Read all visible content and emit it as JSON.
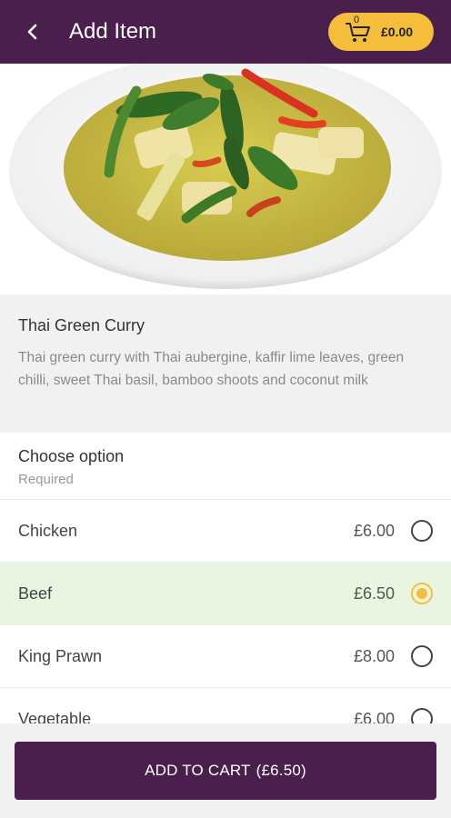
{
  "appbar": {
    "title": "Add Item",
    "back_icon": "arrow-left-icon"
  },
  "cart": {
    "count": "0",
    "total": "£0.00",
    "icon": "cart-icon",
    "color": "#f6bd3a"
  },
  "hero": {
    "alt": "Thai Green Curry dish",
    "expand_icon": "expand-icon"
  },
  "item": {
    "name": "Thai Green Curry",
    "description": "Thai green curry with Thai aubergine, kaffir lime leaves, green chilli, sweet Thai basil, bamboo shoots and coconut milk"
  },
  "options": {
    "title": "Choose option",
    "required": "Required",
    "items": [
      {
        "label": "Chicken",
        "price": "£6.00",
        "selected": false
      },
      {
        "label": "Beef",
        "price": "£6.50",
        "selected": true
      },
      {
        "label": "King Prawn",
        "price": "£8.00",
        "selected": false
      },
      {
        "label": "Vegetable",
        "price": "£6.00",
        "selected": false
      }
    ]
  },
  "footer": {
    "add_label": "ADD TO CART",
    "add_price": "(£6.50)"
  },
  "colors": {
    "brand": "#4a1f4e",
    "accent": "#f6bd3a",
    "selected_row": "#e9f5e1"
  }
}
